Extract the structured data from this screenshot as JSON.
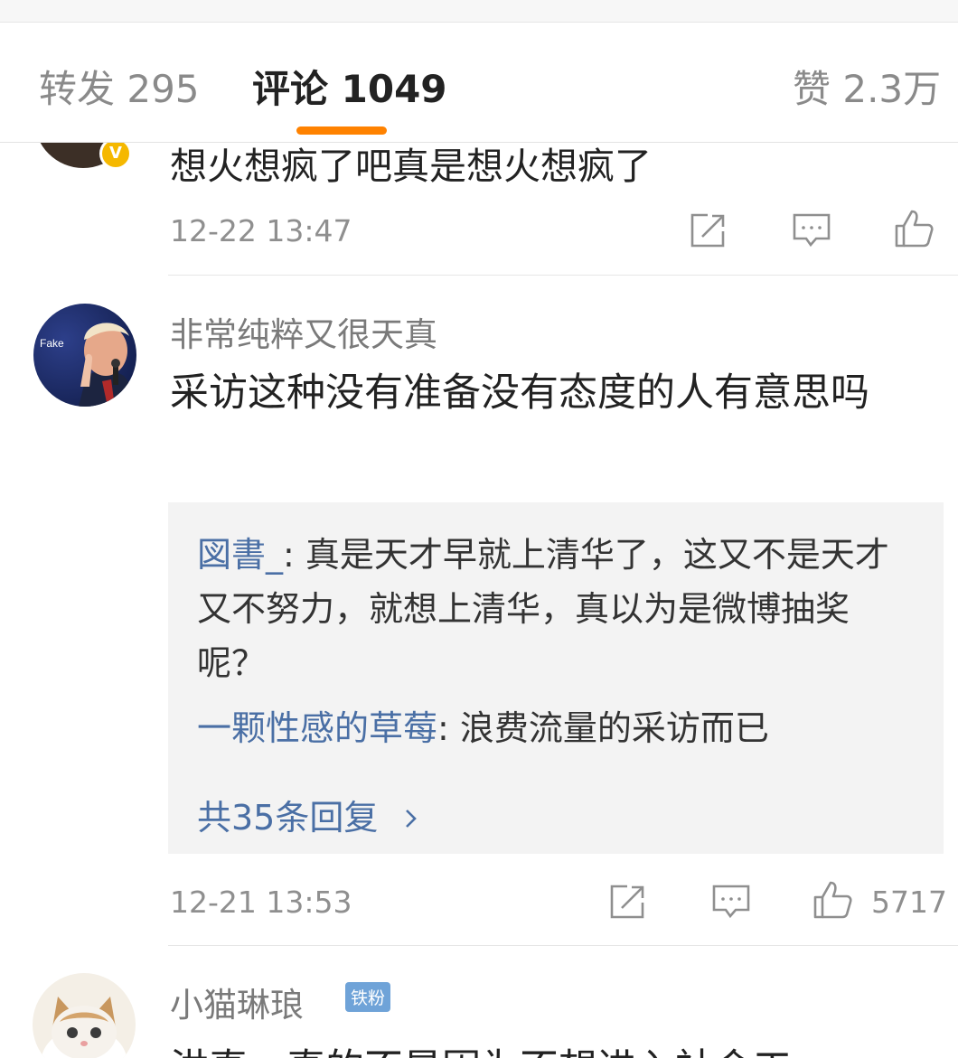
{
  "tabs": {
    "repost_label": "转发 295",
    "comments_label": "评论 1049",
    "likes_label": "赞 2.3万",
    "accent_color": "#ff8200"
  },
  "comments": [
    {
      "text": "想火想疯了吧真是想火想疯了",
      "time": "12-22 13:47",
      "badge": "V",
      "icons": [
        "share-icon",
        "comment-icon",
        "like-icon"
      ]
    },
    {
      "username": "非常纯粹又很天真",
      "avatar_caption": "Fake",
      "text": "采访这种没有准备没有态度的人有意思吗",
      "replies": [
        {
          "name": "図書_",
          "sep": ":",
          "text": " 真是天才早就上清华了，这又不是天才又不努力，就想上清华，真以为是微博抽奖呢？"
        },
        {
          "name": "一颗性感的草莓",
          "sep": ":",
          "text": " 浪费流量的采访而已"
        }
      ],
      "reply_total": "共35条回复",
      "time": "12-21 13:53",
      "likes": "5717",
      "icons": [
        "share-icon",
        "comment-icon",
        "like-icon"
      ]
    },
    {
      "username": "小猫琳琅",
      "badge": "铁粉",
      "text": "洪真，真的不是因为不想进入社会工"
    }
  ],
  "colors": {
    "link": "#4a6fa5",
    "reply_bg": "#f3f3f3",
    "secondary_text": "#8f8f8f"
  }
}
